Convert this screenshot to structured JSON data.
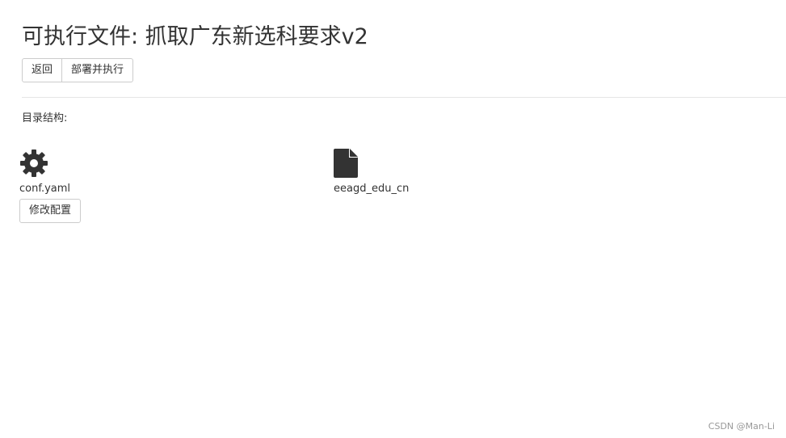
{
  "page": {
    "title": "可执行文件: 抓取广东新选科要求v2"
  },
  "actions": {
    "back_label": "返回",
    "deploy_label": "部署并执行"
  },
  "section": {
    "label": "目录结构:"
  },
  "files": [
    {
      "name": "conf.yaml",
      "icon": "gear-icon",
      "action_label": "修改配置"
    },
    {
      "name": "eeagd_edu_cn",
      "icon": "file-icon"
    }
  ],
  "watermark": "CSDN @Man-Li",
  "colors": {
    "text": "#333333",
    "icon": "#333333",
    "border": "#cccccc",
    "divider": "#e6e6e6"
  }
}
